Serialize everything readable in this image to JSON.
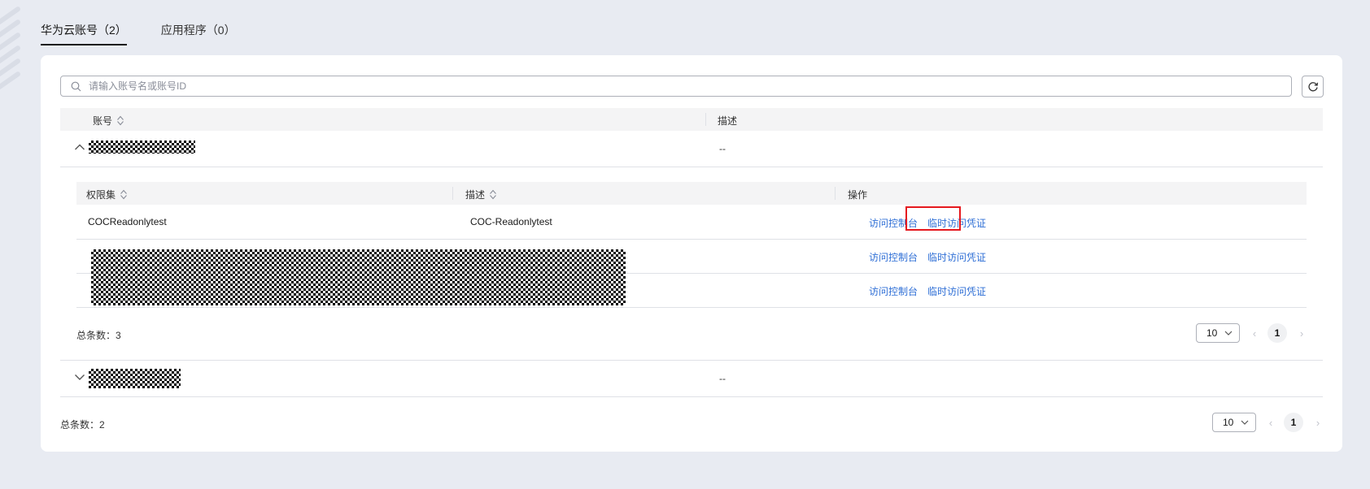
{
  "tabs": [
    {
      "label": "华为云账号（2）",
      "active": true
    },
    {
      "label": "应用程序（0）",
      "active": false
    }
  ],
  "search": {
    "placeholder": "请输入账号名或账号ID",
    "value": ""
  },
  "accounts_table": {
    "columns": [
      "账号",
      "描述"
    ],
    "rows": [
      {
        "name_redacted": true,
        "description": "--",
        "expanded": true
      },
      {
        "name_redacted": true,
        "description": "--",
        "expanded": false
      }
    ],
    "total": "总条数：2",
    "page_size": "10",
    "page": "1"
  },
  "permission_sets": {
    "columns": [
      "权限集",
      "描述",
      "操作"
    ],
    "rows": [
      {
        "name": "COCReadonlytest",
        "description": "COC-Readonlytest",
        "action_console": "访问控制台",
        "action_credentials": "临时访问凭证",
        "highlighted": true
      },
      {
        "name_redacted": true,
        "action_console": "访问控制台",
        "action_credentials": "临时访问凭证"
      },
      {
        "name_redacted": true,
        "action_console": "访问控制台",
        "action_credentials": "临时访问凭证"
      }
    ],
    "total": "总条数：3",
    "page_size": "10",
    "page": "1"
  },
  "colors": {
    "accent_link": "#2f6fd6",
    "highlight_box": "#e5181e",
    "background": "#e8ebf2"
  },
  "icons": [
    "search-icon",
    "refresh-icon",
    "sort-icon",
    "chevron-up-icon",
    "chevron-down-icon",
    "chevron-left-icon",
    "chevron-right-icon"
  ]
}
